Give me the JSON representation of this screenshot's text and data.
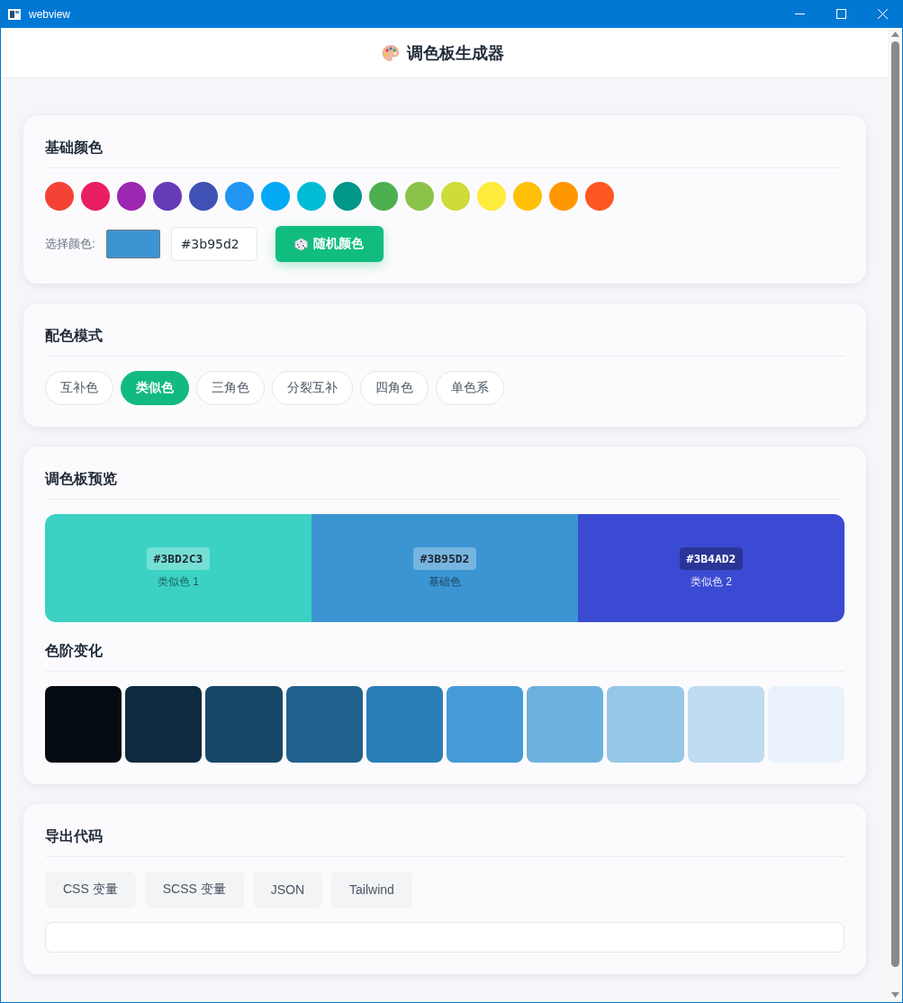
{
  "window": {
    "title": "webview"
  },
  "header": {
    "title": "调色板生成器"
  },
  "base_colors": {
    "title": "基础颜色",
    "swatches": [
      {
        "color": "#f44336"
      },
      {
        "color": "#e91e63"
      },
      {
        "color": "#9c27b0"
      },
      {
        "color": "#673ab7"
      },
      {
        "color": "#3f51b5"
      },
      {
        "color": "#2196f3"
      },
      {
        "color": "#03a9f4"
      },
      {
        "color": "#00bcd4"
      },
      {
        "color": "#009688"
      },
      {
        "color": "#4caf50"
      },
      {
        "color": "#8bc34a"
      },
      {
        "color": "#cddc39"
      },
      {
        "color": "#ffeb3b"
      },
      {
        "color": "#ffc107"
      },
      {
        "color": "#ff9800"
      },
      {
        "color": "#ff5722"
      }
    ],
    "picker_label": "选择颜色:",
    "picker": {
      "color": "#3b95d2"
    },
    "hex_input": {
      "value": "#3b95d2"
    },
    "random_button": {
      "label": "随机颜色"
    }
  },
  "scheme": {
    "title": "配色模式",
    "modes": [
      {
        "label": "互补色",
        "selected": false
      },
      {
        "label": "类似色",
        "selected": true
      },
      {
        "label": "三角色",
        "selected": false
      },
      {
        "label": "分裂互补",
        "selected": false
      },
      {
        "label": "四角色",
        "selected": false
      },
      {
        "label": "单色系",
        "selected": false
      }
    ]
  },
  "preview": {
    "title": "调色板预览",
    "colors": [
      {
        "hex": "#3BD2C3",
        "name": "类似色 1",
        "color": "#3bd2c3"
      },
      {
        "hex": "#3B95D2",
        "name": "基础色",
        "color": "#3b95d2"
      },
      {
        "hex": "#3B4AD2",
        "name": "类似色 2",
        "color": "#3b4ad2"
      }
    ],
    "shades": {
      "title": "色阶变化",
      "swatches": [
        {
          "color": "#050c14"
        },
        {
          "color": "#0f2a3e"
        },
        {
          "color": "#184767"
        },
        {
          "color": "#21628e"
        },
        {
          "color": "#2a7eb7"
        },
        {
          "color": "#459bd6"
        },
        {
          "color": "#6db1de"
        },
        {
          "color": "#96c7e7"
        },
        {
          "color": "#bfdcf0"
        },
        {
          "color": "#eaf3fb"
        }
      ]
    }
  },
  "export": {
    "title": "导出代码",
    "formats": [
      {
        "label": "CSS 变量"
      },
      {
        "label": "SCSS 变量"
      },
      {
        "label": "JSON"
      },
      {
        "label": "Tailwind"
      }
    ]
  }
}
